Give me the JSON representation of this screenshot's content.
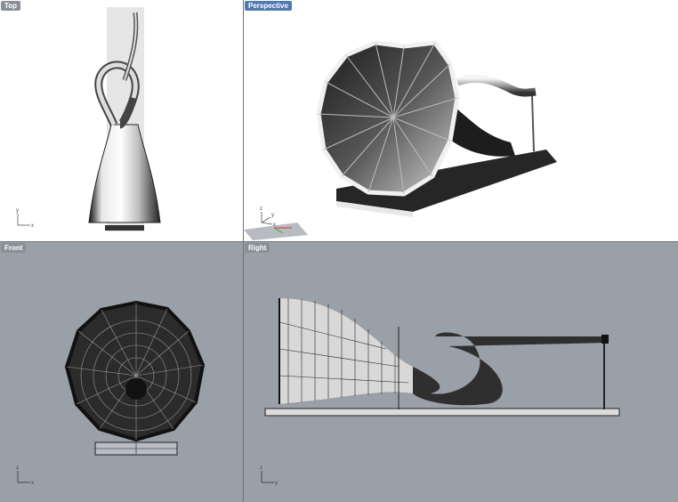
{
  "viewports": {
    "top": {
      "label": "Top"
    },
    "perspective": {
      "label": "Perspective"
    },
    "front": {
      "label": "Front"
    },
    "right": {
      "label": "Right"
    }
  },
  "axes": {
    "x": "x",
    "y": "y",
    "z": "z"
  },
  "colors": {
    "active_tab": "#4f79b0",
    "inactive_tab": "#8a8f96",
    "shaded_bg": "#ffffff",
    "wire_bg": "#9aa0a8"
  }
}
